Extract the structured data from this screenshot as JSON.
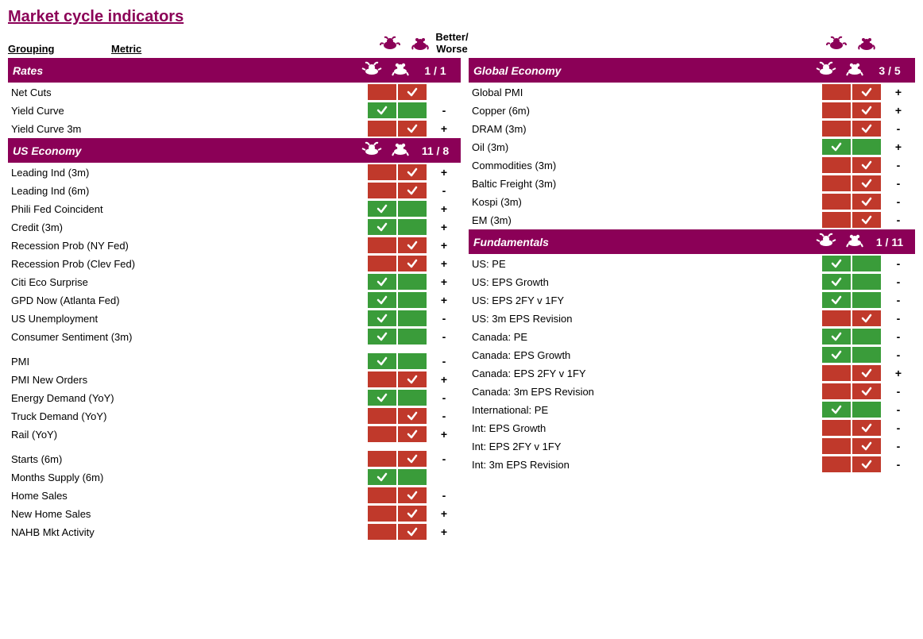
{
  "title": "Market cycle indicators",
  "better_worse": "Better/\nWorse",
  "col_headers": {
    "grouping": "Grouping",
    "metric": "Metric"
  },
  "left": {
    "sections": [
      {
        "id": "rates",
        "label": "Rates",
        "score": "1 / 1",
        "rows": [
          {
            "metric": "Net Cuts",
            "bull": false,
            "bear": true,
            "bw": ""
          },
          {
            "metric": "Yield Curve",
            "bull": true,
            "bear": false,
            "bw": "-"
          },
          {
            "metric": "Yield Curve 3m",
            "bull": false,
            "bear": true,
            "bw": "+"
          }
        ]
      },
      {
        "id": "us_economy",
        "label": "US Economy",
        "score": "11 / 8",
        "groups": [
          {
            "rows": [
              {
                "metric": "Leading Ind (3m)",
                "bull": false,
                "bear": true,
                "bw": "+"
              },
              {
                "metric": "Leading Ind (6m)",
                "bull": false,
                "bear": true,
                "bw": "-"
              },
              {
                "metric": "Phili Fed Coincident",
                "bull": true,
                "bear": false,
                "bw": "+"
              },
              {
                "metric": "Credit (3m)",
                "bull": true,
                "bear": false,
                "bw": "+"
              },
              {
                "metric": "Recession Prob (NY Fed)",
                "bull": false,
                "bear": true,
                "bw": "+"
              },
              {
                "metric": "Recession Prob (Clev Fed)",
                "bull": false,
                "bear": true,
                "bw": "+"
              },
              {
                "metric": "Citi Eco Surprise",
                "bull": true,
                "bear": false,
                "bw": "+"
              },
              {
                "metric": "GPD Now (Atlanta Fed)",
                "bull": true,
                "bear": false,
                "bw": "+"
              },
              {
                "metric": "US Unemployment",
                "bull": true,
                "bear": false,
                "bw": "-"
              },
              {
                "metric": "Consumer Sentiment (3m)",
                "bull": true,
                "bear": false,
                "bw": "-"
              }
            ]
          },
          {
            "rows": [
              {
                "metric": "PMI",
                "bull": true,
                "bear": false,
                "bw": "-"
              },
              {
                "metric": "PMI New Orders",
                "bull": false,
                "bear": true,
                "bw": "+"
              },
              {
                "metric": "Energy Demand (YoY)",
                "bull": true,
                "bear": false,
                "bw": "-"
              },
              {
                "metric": "Truck Demand (YoY)",
                "bull": false,
                "bear": true,
                "bw": "-"
              },
              {
                "metric": "Rail (YoY)",
                "bull": false,
                "bear": true,
                "bw": "+"
              }
            ]
          },
          {
            "rows": [
              {
                "metric": "Starts (6m)",
                "bull": false,
                "bear": true,
                "bw": "-"
              },
              {
                "metric": "Months Supply (6m)",
                "bull": true,
                "bear": false,
                "bw": ""
              },
              {
                "metric": "Home Sales",
                "bull": false,
                "bear": true,
                "bw": "-"
              },
              {
                "metric": "New Home Sales",
                "bull": false,
                "bear": true,
                "bw": "+"
              },
              {
                "metric": "NAHB Mkt Activity",
                "bull": false,
                "bear": true,
                "bw": "+"
              }
            ]
          }
        ]
      }
    ]
  },
  "right": {
    "sections": [
      {
        "id": "global_economy",
        "label": "Global Economy",
        "score": "3 / 5",
        "rows": [
          {
            "metric": "Global PMI",
            "bull": false,
            "bear": true,
            "bw": "+"
          },
          {
            "metric": "Copper (6m)",
            "bull": false,
            "bear": true,
            "bw": "+"
          },
          {
            "metric": "DRAM (3m)",
            "bull": false,
            "bear": true,
            "bw": "-"
          },
          {
            "metric": "Oil (3m)",
            "bull": true,
            "bear": false,
            "bw": "+"
          },
          {
            "metric": "Commodities (3m)",
            "bull": false,
            "bear": true,
            "bw": "-"
          },
          {
            "metric": "Baltic Freight (3m)",
            "bull": false,
            "bear": true,
            "bw": "-"
          },
          {
            "metric": "Kospi (3m)",
            "bull": false,
            "bear": true,
            "bw": "-"
          },
          {
            "metric": "EM (3m)",
            "bull": false,
            "bear": true,
            "bw": "-"
          }
        ]
      },
      {
        "id": "fundamentals",
        "label": "Fundamentals",
        "score": "1 / 11",
        "rows": [
          {
            "metric": "US: PE",
            "bull": true,
            "bear": false,
            "bw": "-"
          },
          {
            "metric": "US: EPS Growth",
            "bull": true,
            "bear": false,
            "bw": "-"
          },
          {
            "metric": "US: EPS 2FY v 1FY",
            "bull": true,
            "bear": false,
            "bw": "-"
          },
          {
            "metric": "US: 3m EPS Revision",
            "bull": false,
            "bear": true,
            "bw": "-"
          },
          {
            "metric": "Canada: PE",
            "bull": true,
            "bear": false,
            "bw": "-"
          },
          {
            "metric": "Canada: EPS Growth",
            "bull": true,
            "bear": false,
            "bw": "-"
          },
          {
            "metric": "Canada: EPS 2FY v 1FY",
            "bull": false,
            "bear": true,
            "bw": "+"
          },
          {
            "metric": "Canada: 3m EPS Revision",
            "bull": false,
            "bear": true,
            "bw": "-"
          },
          {
            "metric": "International: PE",
            "bull": true,
            "bear": false,
            "bw": "-"
          },
          {
            "metric": "Int: EPS Growth",
            "bull": false,
            "bear": true,
            "bw": "-"
          },
          {
            "metric": "Int: EPS 2FY v 1FY",
            "bull": false,
            "bear": true,
            "bw": "-"
          },
          {
            "metric": "Int: 3m EPS Revision",
            "bull": false,
            "bear": true,
            "bw": "-"
          }
        ]
      }
    ]
  }
}
